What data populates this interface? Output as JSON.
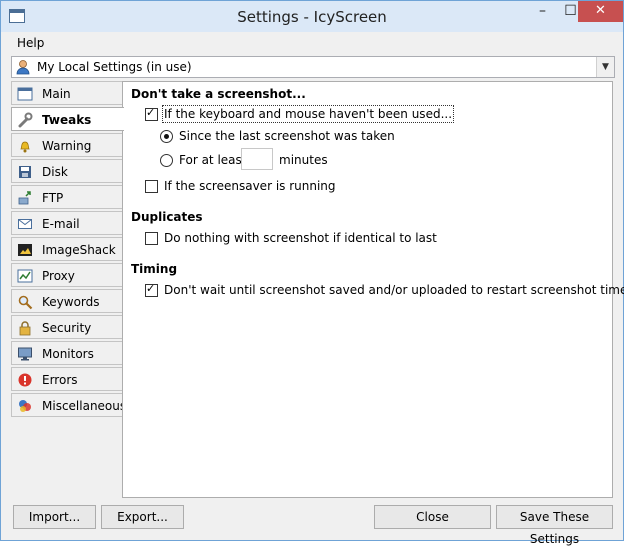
{
  "window": {
    "title": "Settings - IcyScreen",
    "close_glyph": "✕",
    "minimize_glyph": "–",
    "maximize_glyph": "☐"
  },
  "menu": {
    "items": [
      {
        "label": "Help"
      }
    ]
  },
  "profile": {
    "selected": "My Local Settings (in use)",
    "icon": "user-icon"
  },
  "sidebar": {
    "items": [
      {
        "label": "Main",
        "icon": "window-icon",
        "active": false
      },
      {
        "label": "Tweaks",
        "icon": "wrench-icon",
        "active": true
      },
      {
        "label": "Warning",
        "icon": "bell-icon",
        "active": false
      },
      {
        "label": "Disk",
        "icon": "disk-icon",
        "active": false
      },
      {
        "label": "FTP",
        "icon": "ftp-icon",
        "active": false
      },
      {
        "label": "E-mail",
        "icon": "envelope-icon",
        "active": false
      },
      {
        "label": "ImageShack",
        "icon": "imageshack-icon",
        "active": false
      },
      {
        "label": "Proxy",
        "icon": "proxy-icon",
        "active": false
      },
      {
        "label": "Keywords",
        "icon": "magnifier-icon",
        "active": false
      },
      {
        "label": "Security",
        "icon": "lock-icon",
        "active": false
      },
      {
        "label": "Monitors",
        "icon": "monitor-icon",
        "active": false
      },
      {
        "label": "Errors",
        "icon": "error-icon",
        "active": false
      },
      {
        "label": "Miscellaneous",
        "icon": "misc-icon",
        "active": false
      }
    ]
  },
  "tweaks": {
    "section_dont_take": "Don't take a screenshot...",
    "keyboard_mouse": {
      "label": "If the keyboard and mouse haven't been used...",
      "checked": true
    },
    "since_last": {
      "label": "Since the last screenshot was taken",
      "selected": true
    },
    "for_at_least": {
      "label": "For at least",
      "value": "",
      "suffix": "minutes",
      "selected": false
    },
    "screensaver": {
      "label": "If the screensaver is running",
      "checked": false
    },
    "section_duplicates": "Duplicates",
    "do_nothing": {
      "label": "Do nothing with screenshot if identical to last",
      "checked": false
    },
    "section_timing": "Timing",
    "dont_wait": {
      "label": "Don't wait until screenshot saved and/or uploaded to restart screenshot timer",
      "checked": true
    }
  },
  "buttons": {
    "import": "Import...",
    "export": "Export...",
    "close": "Close",
    "save": "Save These Settings"
  },
  "colors": {
    "title_bg": "#dbe8f7",
    "close_btn": "#c75050",
    "window_bg": "#f0f0f0"
  }
}
